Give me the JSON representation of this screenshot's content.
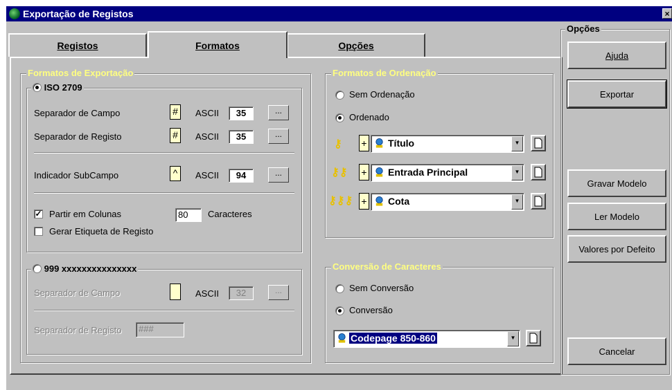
{
  "window": {
    "title": "Exportação de Registos",
    "close": "×"
  },
  "tabs": [
    {
      "label": "Registos"
    },
    {
      "label": "Formatos"
    },
    {
      "label": "Opções"
    }
  ],
  "formats": {
    "group_title": "Formatos de Exportação",
    "iso": {
      "label": "ISO 2709",
      "field_sep_label": "Separador de Campo",
      "field_sep_char": "#",
      "ascii_label": "ASCII",
      "field_sep_ascii": "35",
      "record_sep_label": "Separador de Registo",
      "record_sep_char": "#",
      "record_sep_ascii": "35",
      "subfield_label": "Indicador SubCampo",
      "subfield_char": "^",
      "subfield_ascii": "94",
      "browse": "...",
      "split_label": "Partir em Colunas",
      "split_value": "80",
      "chars_label": "Caracteres",
      "tag_label": "Gerar Etiqueta de Registo"
    },
    "f999": {
      "label": "999  xxxxxxxxxxxxxxx",
      "field_sep_label": "Separador de Campo",
      "ascii_label": "ASCII",
      "field_sep_ascii": "32",
      "record_sep_label": "Separador de Registo",
      "record_sep_value": "###"
    }
  },
  "ordering": {
    "group_title": "Formatos de Ordenação",
    "none_label": "Sem Ordenação",
    "ordered_label": "Ordenado",
    "keys": [
      {
        "keys": "1",
        "plus": "+",
        "value": "Título"
      },
      {
        "keys": "2",
        "plus": "+",
        "value": "Entrada Principal"
      },
      {
        "keys": "3",
        "plus": "+",
        "value": "Cota"
      }
    ]
  },
  "conversion": {
    "group_title": "Conversão de Caracteres",
    "none_label": "Sem Conversão",
    "conv_label": "Conversão",
    "value": "Codepage 850-860"
  },
  "options": {
    "title": "Opções",
    "help": "Ajuda",
    "export": "Exportar",
    "save_model": "Gravar Modelo",
    "read_model": "Ler Modelo",
    "defaults": "Valores por Defeito",
    "cancel": "Cancelar"
  }
}
